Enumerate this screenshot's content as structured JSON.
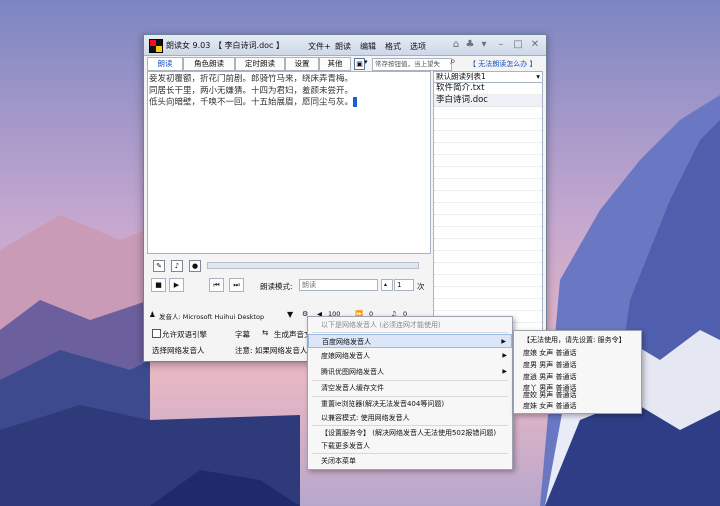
{
  "window": {
    "app_name": "朗读女 9.03",
    "doc_title": "【 李白诗词.doc 】",
    "menu": [
      "文件+",
      "朗读",
      "编辑",
      "格式",
      "选项"
    ],
    "warning_link": "【 无法朗读怎么办 】"
  },
  "tabs": [
    "朗读",
    "角色朗读",
    "定时朗读",
    "设置",
    "其他"
  ],
  "search": {
    "value": "常存按钮值，当上望失"
  },
  "editor": {
    "lines": [
      "妾发初覆额，折花门前剧。郎骑竹马来，绕床弄青梅。",
      "同居长干里，两小无嫌猜。十四为君妇，羞颜未尝开。",
      "低头向暗壁，千唤不一回。十五始展眉，愿同尘与灰。"
    ]
  },
  "playlist": {
    "selector": "默认朗读列表1",
    "items": [
      "软件简介.txt",
      "李白诗词.doc"
    ]
  },
  "controls": {
    "mode_label": "朗读模式:",
    "mode_value": "朗读",
    "repeat_value": "1",
    "repeat_unit": "次",
    "speaker_label": "发音人: Microsoft Huihui Desktop",
    "volume_value": "100",
    "speed_value": "0",
    "pitch_value": "0"
  },
  "bottom": {
    "allow_engine": "允许双语引擎",
    "subtitle": "字幕",
    "generate_audio": "生成声音文件",
    "select_speaker": "选择网络发音人",
    "note": "注意: 如果网络发音人"
  },
  "context_menu": {
    "header": "以下是网络发音人 (必须连网才能使用)",
    "items": [
      "百度网络发音人",
      "度娘网络发音人",
      "腾讯优图网络发音人",
      "清空发音人缓存文件",
      "重置ie浏览器(解决无法发音404等问题)",
      "以兼容模式: 使用网络发音人",
      "【设置服务令】 (解决网络发音人无法使用502报错问题)",
      "下载更多发音人",
      "关闭本菜单"
    ]
  },
  "submenu": {
    "header": "【无法使用，请先设置: 服务令】",
    "items": [
      "度娘 女声 普通话",
      "度男 男声 普通话",
      "度逍 男声 普通话",
      "度丫 男声 普通话",
      "度姣 男声 普通话",
      "度妹 女声 普通话"
    ]
  }
}
